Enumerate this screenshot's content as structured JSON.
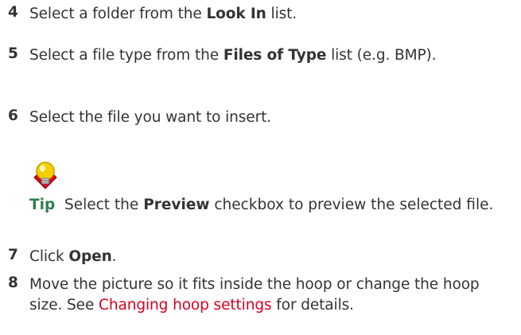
{
  "steps": [
    {
      "number": "4",
      "pre": "Select a folder from the ",
      "bold": "Look In",
      "post": " list."
    },
    {
      "number": "5",
      "pre": "Select a file type from the ",
      "bold": "Files of Type",
      "post": " list (e.g. BMP)."
    },
    {
      "number": "6",
      "text": "Select the file you want to insert."
    },
    {
      "number": "7",
      "pre": "Click ",
      "bold": "Open",
      "post": "."
    },
    {
      "number": "8",
      "pre": "Move the picture so it fits inside the hoop or change the hoop size. See ",
      "link": "Changing hoop settings",
      "post": " for details."
    }
  ],
  "tip": {
    "label": "Tip",
    "pre": "  Select the ",
    "bold": "Preview",
    "post": " checkbox to preview the selected file."
  },
  "colors": {
    "text": "#333333",
    "link": "#d9001e",
    "tip_label": "#2e7d4f",
    "bulb": "#f5d000",
    "diamond": "#d9001e"
  },
  "icons": {
    "tip": "lightbulb-icon"
  }
}
